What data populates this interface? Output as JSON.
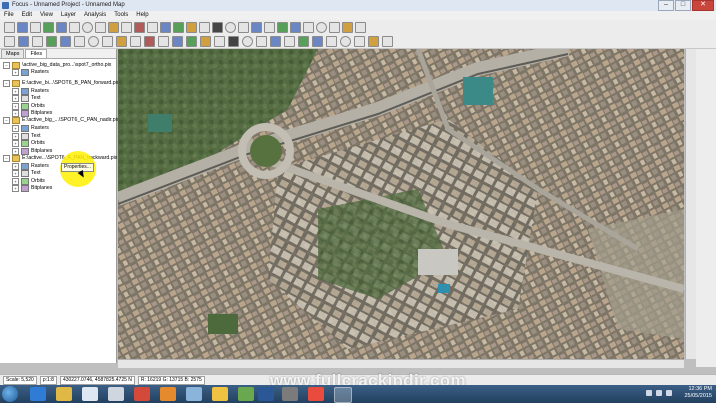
{
  "window": {
    "title": "Focus - Unnamed Project - Unnamed Map",
    "minimize": "–",
    "maximize": "□",
    "close": "✕"
  },
  "menu": [
    "File",
    "Edit",
    "View",
    "Layer",
    "Analysis",
    "Tools",
    "Help"
  ],
  "panel": {
    "tabs": [
      "Maps",
      "Files"
    ],
    "active_tab": "Files",
    "tree": [
      {
        "label": "\\active_big_data_pro...\\spot7_ortho.pix",
        "kind": "folder",
        "level": 0
      },
      {
        "label": "Rasters",
        "kind": "layer",
        "level": 1
      },
      {
        "label": "E:\\active_bi...\\SPOT6_B_PAN_forward.pix",
        "kind": "folder",
        "level": 0
      },
      {
        "label": "Rasters",
        "kind": "layer",
        "level": 1
      },
      {
        "label": "Text",
        "kind": "text",
        "level": 1
      },
      {
        "label": "Orbits",
        "kind": "orbit",
        "level": 1
      },
      {
        "label": "Bitplanes",
        "kind": "bitplane",
        "level": 1
      },
      {
        "label": "E:\\active_big_...\\SPOT6_C_PAN_nadir.pix",
        "kind": "folder",
        "level": 0
      },
      {
        "label": "Rasters",
        "kind": "layer",
        "level": 1
      },
      {
        "label": "Text",
        "kind": "text",
        "level": 1
      },
      {
        "label": "Orbits",
        "kind": "orbit",
        "level": 1
      },
      {
        "label": "Bitplanes",
        "kind": "bitplane",
        "level": 1
      },
      {
        "label": "E:\\active...\\SPOT6_A_PAN_backward.pix",
        "kind": "folder",
        "level": 0
      },
      {
        "label": "Rasters",
        "kind": "layer",
        "level": 1
      },
      {
        "label": "Text",
        "kind": "text",
        "level": 1
      },
      {
        "label": "Orbits",
        "kind": "orbit",
        "level": 1
      },
      {
        "label": "Bitplanes",
        "kind": "bitplane",
        "level": 1
      }
    ],
    "tooltip": "Properties..."
  },
  "status": {
    "scale": "Scale: 5,520",
    "zoom": "p:1:8",
    "coords": "430227.0746, 4587825.4725 N",
    "pixel": "R: 16219 G: 13715 B: 2575"
  },
  "taskbar": {
    "time": "12:36 PM",
    "date": "25/05/2015"
  },
  "watermark": "www.fullcrackindir.com"
}
